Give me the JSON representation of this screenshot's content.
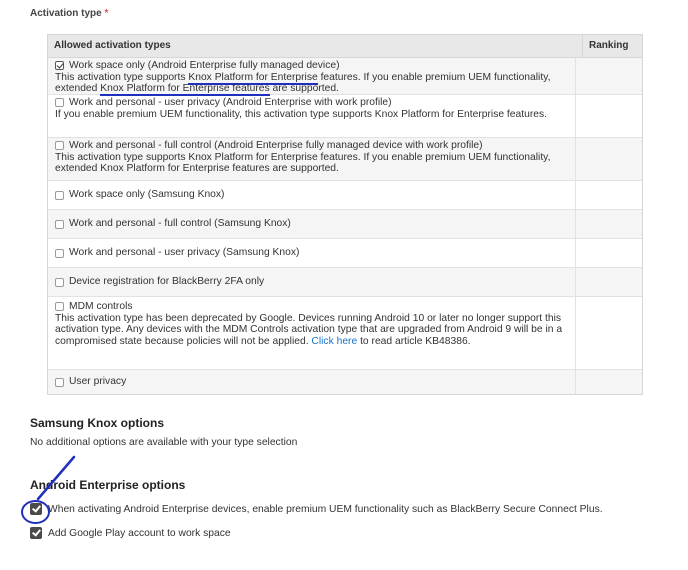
{
  "activation": {
    "label": "Activation type",
    "required_mark": "*",
    "header_main": "Allowed activation types",
    "header_rank": "Ranking",
    "rows": [
      {
        "label": "Work space only (Android Enterprise fully managed device)",
        "checked": true,
        "desc_a": "This activation type supports ",
        "desc_link1": "Knox Platform for Enterprise",
        "desc_b": " features. If you enable premium UEM functionality, extended ",
        "desc_link2": "Knox Platform for Enterprise features",
        "desc_c": " are supported."
      },
      {
        "label": "Work and personal - user privacy (Android Enterprise with work profile)",
        "checked": false,
        "desc": "If you enable premium UEM functionality, this activation type supports Knox Platform for Enterprise features."
      },
      {
        "label": "Work and personal - full control (Android Enterprise fully managed device with work profile)",
        "checked": false,
        "desc": "This activation type supports Knox Platform for Enterprise features. If you enable premium UEM functionality, extended Knox Platform for Enterprise features are supported."
      },
      {
        "label": "Work space only (Samsung Knox)",
        "checked": false
      },
      {
        "label": "Work and personal - full control (Samsung Knox)",
        "checked": false
      },
      {
        "label": "Work and personal - user privacy (Samsung Knox)",
        "checked": false
      },
      {
        "label": "Device registration for BlackBerry 2FA only",
        "checked": false
      },
      {
        "label": "MDM controls",
        "checked": false,
        "desc_a": "This activation type has been deprecated by Google. Devices running Android 10 or later no longer support this activation type. Any devices with the MDM Controls activation type that are upgraded from Android 9 will be in a compromised state because policies will not be applied. ",
        "desc_link": "Click here",
        "desc_b": " to read article KB48386."
      },
      {
        "label": "User privacy",
        "checked": false
      }
    ]
  },
  "samsung": {
    "title": "Samsung Knox options",
    "text": "No additional options are available with your type selection"
  },
  "android": {
    "title": "Android Enterprise options",
    "opt1": "When activating Android Enterprise devices, enable premium UEM functionality such as BlackBerry Secure Connect Plus.",
    "opt1_checked": true,
    "opt2": "Add Google Play account to work space",
    "opt2_checked": true
  },
  "colors": {
    "annotation": "#1f2fbf",
    "link": "#1a73c8",
    "header_bg": "#e8e8e8"
  }
}
